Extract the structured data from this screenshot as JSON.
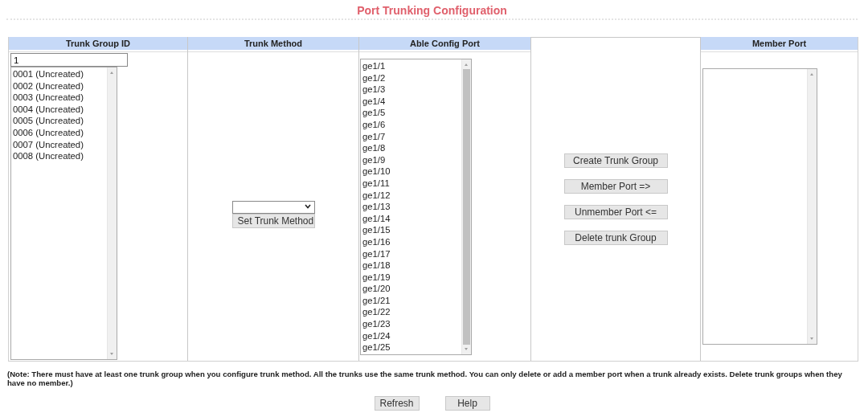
{
  "title": "Port Trunking Configuration",
  "trunk_group_id": {
    "heading": "Trunk Group ID",
    "input_value": "1",
    "list": [
      {
        "label": "0001 (Uncreated)",
        "selected": false
      },
      {
        "label": "0002 (Uncreated)",
        "selected": false
      },
      {
        "label": "0003 (Uncreated)",
        "selected": false
      },
      {
        "label": "0004 (Uncreated)",
        "selected": false
      },
      {
        "label": "0005 (Uncreated)",
        "selected": false
      },
      {
        "label": "0006 (Uncreated)",
        "selected": false
      },
      {
        "label": "0007 (Uncreated)",
        "selected": false
      },
      {
        "label": "0008 (Uncreated)",
        "selected": false
      }
    ]
  },
  "trunk_method": {
    "heading": "Trunk Method",
    "button": "Set Trunk Method"
  },
  "able_config_port": {
    "heading": "Able Config Port",
    "list": [
      {
        "label": "ge1/1",
        "selected": false
      },
      {
        "label": "ge1/2",
        "selected": false
      },
      {
        "label": "ge1/3",
        "selected": false
      },
      {
        "label": "ge1/4",
        "selected": false
      },
      {
        "label": "ge1/5",
        "selected": false
      },
      {
        "label": "ge1/6",
        "selected": false
      },
      {
        "label": "ge1/7",
        "selected": false
      },
      {
        "label": "ge1/8",
        "selected": false
      },
      {
        "label": "ge1/9",
        "selected": false
      },
      {
        "label": "ge1/10",
        "selected": false
      },
      {
        "label": "ge1/11",
        "selected": false
      },
      {
        "label": "ge1/12",
        "selected": false
      },
      {
        "label": "ge1/13",
        "selected": false
      },
      {
        "label": "ge1/14",
        "selected": false
      },
      {
        "label": "ge1/15",
        "selected": false
      },
      {
        "label": "ge1/16",
        "selected": false
      },
      {
        "label": "ge1/17",
        "selected": false
      },
      {
        "label": "ge1/18",
        "selected": false
      },
      {
        "label": "ge1/19",
        "selected": false
      },
      {
        "label": "ge1/20",
        "selected": false
      },
      {
        "label": "ge1/21",
        "selected": false
      },
      {
        "label": "ge1/22",
        "selected": false
      },
      {
        "label": "ge1/23",
        "selected": false
      },
      {
        "label": "ge1/24",
        "selected": false
      },
      {
        "label": "ge1/25",
        "selected": false
      }
    ]
  },
  "actions": {
    "buttons": [
      "Create Trunk Group",
      "Member Port =>",
      "Unmember Port <=",
      "Delete trunk Group"
    ]
  },
  "member_port": {
    "heading": "Member Port"
  },
  "note": "(Note: There must have at least one trunk group when you configure trunk method. All the trunks use the same trunk method. You can only delete or add a member port when a trunk already exists. Delete trunk groups when they have no member.)",
  "footer_buttons": [
    "Refresh",
    "Help"
  ]
}
